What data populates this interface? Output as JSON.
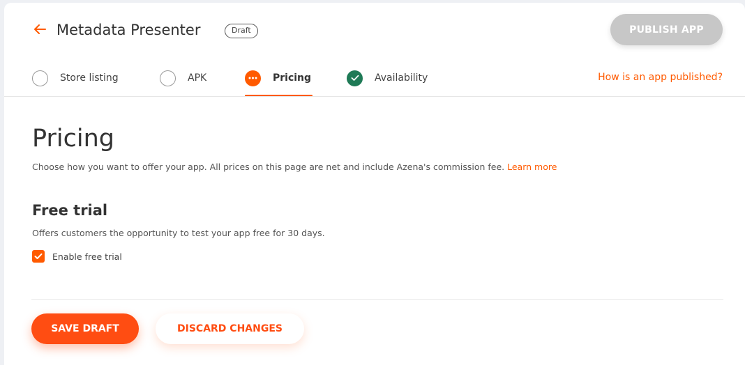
{
  "header": {
    "title": "Metadata Presenter",
    "badge": "Draft",
    "publish_label": "PUBLISH APP"
  },
  "steps": [
    {
      "label": "Store listing",
      "status": "empty"
    },
    {
      "label": "APK",
      "status": "empty"
    },
    {
      "label": "Pricing",
      "status": "active"
    },
    {
      "label": "Availability",
      "status": "done"
    }
  ],
  "help_link": "How is an app published?",
  "main": {
    "title": "Pricing",
    "description": "Choose how you want to offer your app. All prices on this page are net and include Azena's commission fee.",
    "learn_more": "Learn more",
    "free_trial": {
      "title": "Free trial",
      "description": "Offers customers the opportunity to test your app free for 30 days.",
      "checkbox_label": "Enable free trial",
      "checked": true
    }
  },
  "footer": {
    "save_label": "SAVE DRAFT",
    "discard_label": "DISCARD CHANGES"
  },
  "colors": {
    "accent": "#ff5a00",
    "done": "#1f7a56",
    "disabled": "#c7c7c7"
  }
}
